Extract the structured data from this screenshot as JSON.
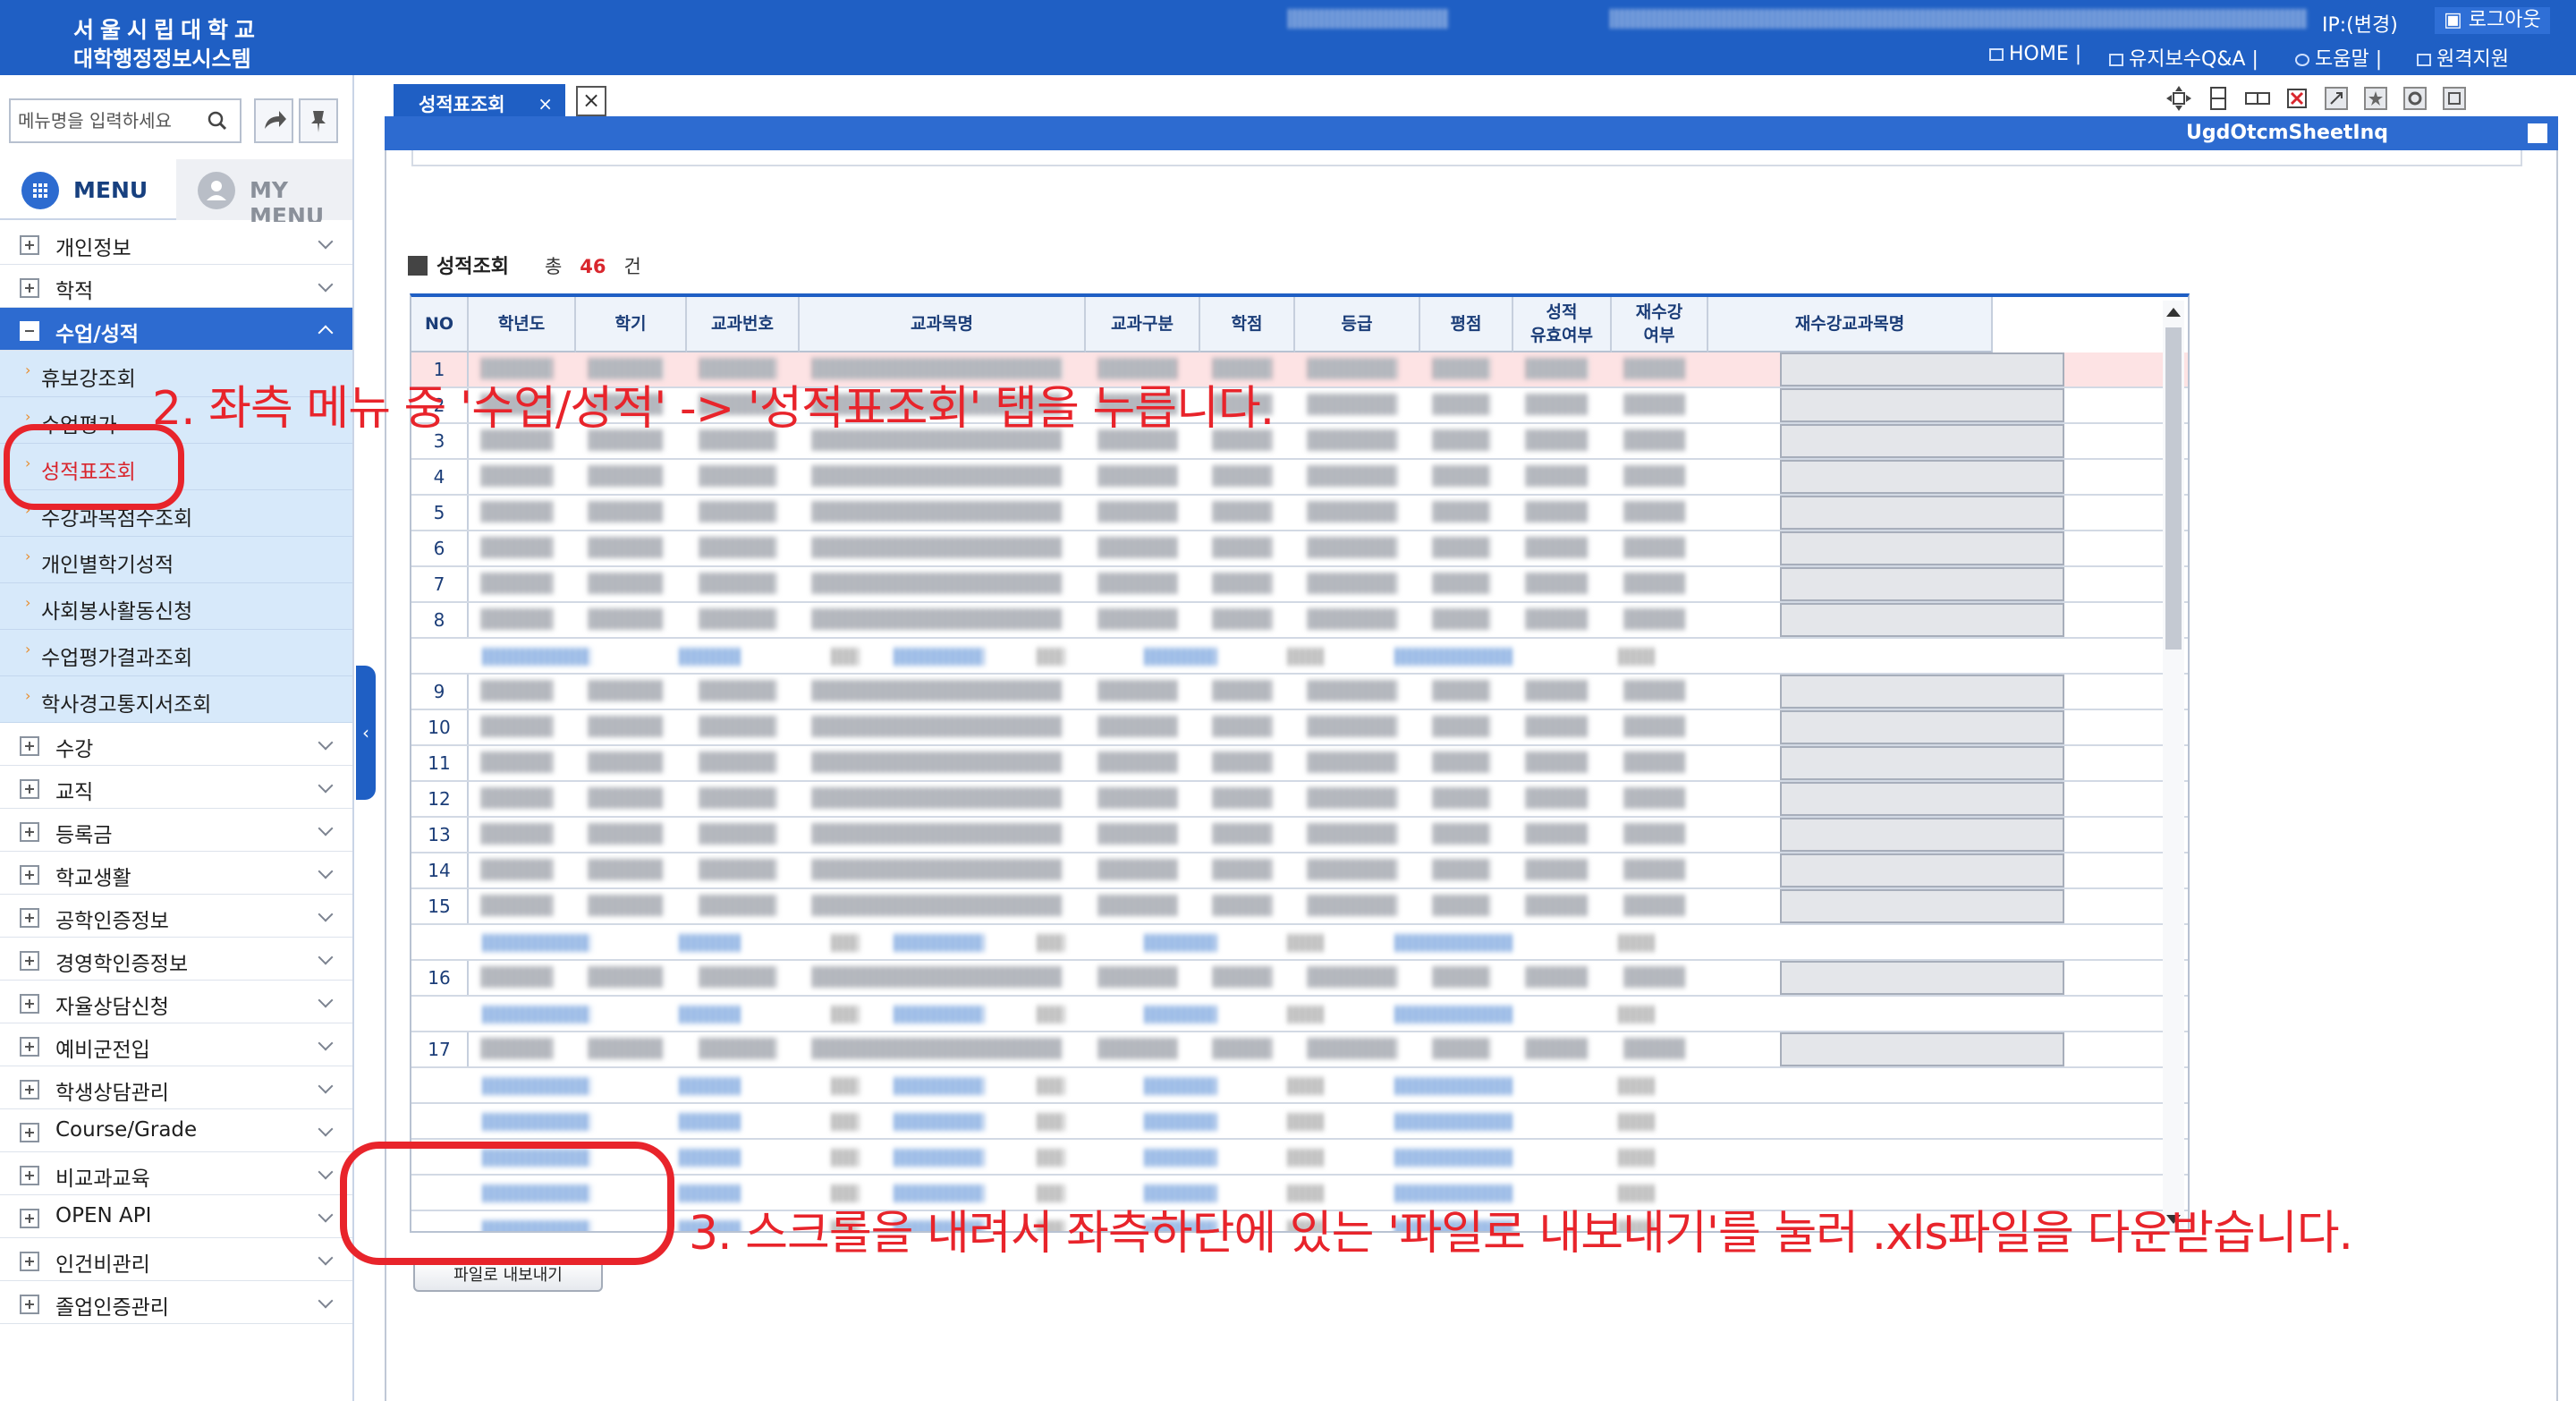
{
  "header": {
    "logo_line1": "서울시립대학교",
    "logo_line2": "대학행정정보시스템",
    "ip_text": "IP:(변경)",
    "logout_label": "로그아웃",
    "links": [
      "HOME |",
      "유지보수Q&A |",
      "도움말 |",
      "원격지원"
    ],
    "brand_color": "#1f5fc4"
  },
  "sidebar": {
    "search_placeholder": "메뉴명을 입력하세요",
    "tabs": [
      "MENU",
      "MY MENU"
    ],
    "items_top": [
      "개인정보",
      "학적"
    ],
    "open_item": "수업/성적",
    "sub_items": [
      "휴보강조회",
      "수업평가",
      "성적표조회",
      "수강과목점수조회",
      "개인별학기성적",
      "사회봉사활동신청",
      "수업평가결과조회",
      "학사경고통지서조회"
    ],
    "current_sub": "성적표조회",
    "items_bottom": [
      "수강",
      "교직",
      "등록금",
      "학교생활",
      "공학인증정보",
      "경영학인증정보",
      "자율상담신청",
      "예비군전입",
      "학생상담관리",
      "Course/Grade",
      "비교과교육",
      "OPEN API",
      "인건비관리",
      "졸업인증관리"
    ]
  },
  "content": {
    "tab_label": "성적표조회",
    "tab_close": "×",
    "screen_id": "UgdOtcmSheetInq",
    "section_title": "성적조회",
    "count_prefix": "총",
    "count_value": "46",
    "count_suffix": "건",
    "columns": [
      "NO",
      "학년도",
      "학기",
      "교과번호",
      "교과목명",
      "교과구분",
      "학점",
      "등급",
      "평점",
      "성적 유효여부",
      "재수강 여부",
      "재수강교과목명"
    ],
    "row_numbers": [
      "1",
      "2",
      "3",
      "4",
      "5",
      "6",
      "7",
      "8",
      "9",
      "10",
      "11",
      "12",
      "13",
      "14",
      "15",
      "16",
      "17"
    ],
    "export_label": "파일로 내보내기"
  },
  "annotations": {
    "step2": "2. 좌측 메뉴 중 '수업/성적' -> '성적표조회' 탭을 누릅니다.",
    "step3": "3. 스크롤을 내려서 좌측하단에 있는 '파일로 내보내기'를 눌러 .xls파일을 다운받습니다.",
    "color": "#e8242b"
  }
}
